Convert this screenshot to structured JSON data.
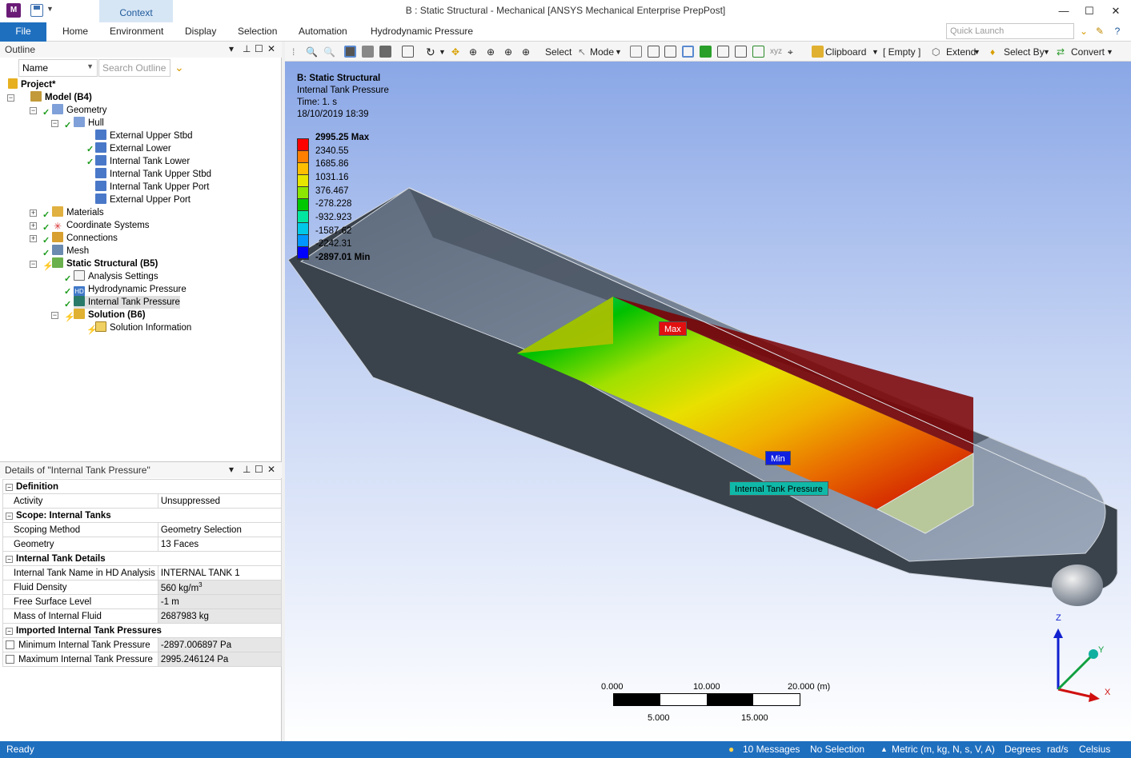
{
  "window": {
    "title": "B : Static Structural - Mechanical [ANSYS Mechanical Enterprise PrepPost]",
    "context_tab": "Context",
    "app_icon_text": "M"
  },
  "ribbon": {
    "file": "File",
    "tabs": [
      "Home",
      "Environment",
      "Display",
      "Selection",
      "Automation",
      "Hydrodynamic Pressure"
    ],
    "quick_launch_placeholder": "Quick Launch"
  },
  "outline": {
    "title": "Outline",
    "filter_value": "Name",
    "search_placeholder": "Search Outline",
    "tree": [
      {
        "label": "Project*",
        "bold": true
      },
      {
        "label": "Model (B4)",
        "bold": true
      },
      {
        "label": "Geometry",
        "bold": false
      },
      {
        "label": "Hull",
        "bold": false
      },
      {
        "label": "External Upper Stbd",
        "bold": false
      },
      {
        "label": "External Lower",
        "bold": false
      },
      {
        "label": "Internal Tank Lower",
        "bold": false
      },
      {
        "label": "Internal Tank Upper Stbd",
        "bold": false
      },
      {
        "label": "Internal Tank Upper Port",
        "bold": false
      },
      {
        "label": "External Upper Port",
        "bold": false
      },
      {
        "label": "Materials",
        "bold": false
      },
      {
        "label": "Coordinate Systems",
        "bold": false
      },
      {
        "label": "Connections",
        "bold": false
      },
      {
        "label": "Mesh",
        "bold": false
      },
      {
        "label": "Static Structural (B5)",
        "bold": true
      },
      {
        "label": "Analysis Settings",
        "bold": false
      },
      {
        "label": "Hydrodynamic Pressure",
        "bold": false
      },
      {
        "label": "Internal Tank Pressure",
        "bold": false
      },
      {
        "label": "Solution (B6)",
        "bold": true
      },
      {
        "label": "Solution Information",
        "bold": false
      }
    ]
  },
  "details": {
    "title": "Details of \"Internal Tank Pressure\"",
    "groups": {
      "definition": "Definition",
      "scope": "Scope: Internal Tanks",
      "tank": "Internal Tank Details",
      "imported": "Imported Internal Tank Pressures"
    },
    "rows": {
      "activity": [
        "Activity",
        "Unsuppressed"
      ],
      "scoping": [
        "Scoping Method",
        "Geometry Selection"
      ],
      "geometry": [
        "Geometry",
        "13 Faces"
      ],
      "tank_name": [
        "Internal Tank Name in HD Analysis",
        "INTERNAL TANK 1"
      ],
      "fluid_density": [
        "Fluid Density",
        "560 kg/m"
      ],
      "fluid_density_exp": "3",
      "free_surface": [
        "Free Surface Level",
        "-1 m"
      ],
      "mass": [
        "Mass of Internal Fluid",
        "2687983 kg"
      ],
      "min_pressure": [
        "Minimum Internal Tank Pressure",
        "-2897.006897 Pa"
      ],
      "max_pressure": [
        "Maximum Internal Tank Pressure",
        "2995.246124 Pa"
      ]
    }
  },
  "graphics_toolbar": {
    "select": "Select",
    "mode": "Mode",
    "clipboard": "Clipboard",
    "empty": "[ Empty ]",
    "extend": "Extend",
    "select_by": "Select By",
    "convert": "Convert"
  },
  "viewport": {
    "analysis": "B: Static Structural",
    "result": "Internal Tank Pressure",
    "time": "Time: 1. s",
    "date": "18/10/2019 18:39",
    "legend": [
      "2995.25 Max",
      "2340.55",
      "1685.86",
      "1031.16",
      "376.467",
      "-278.228",
      "-932.923",
      "-1587.62",
      "-2242.31",
      "-2897.01 Min"
    ],
    "legend_colors": [
      "#ff0000",
      "#ff7f00",
      "#ffbf00",
      "#e6e600",
      "#8ce600",
      "#00c800",
      "#00e6a0",
      "#00c8e6",
      "#0096ff",
      "#0000ff"
    ],
    "max_tag": "Max",
    "min_tag": "Min",
    "probe_tag": "Internal Tank Pressure",
    "scale_top": [
      "0.000",
      "10.000",
      "20.000 (m)"
    ],
    "scale_bottom": [
      "5.000",
      "15.000"
    ],
    "axes": {
      "z": "Z",
      "y": "Y",
      "x": "X"
    }
  },
  "status": {
    "ready": "Ready",
    "messages": "10 Messages",
    "selection": "No Selection",
    "units": "Metric (m, kg, N, s, V, A)",
    "angle": "Degrees",
    "rot": "rad/s",
    "temp": "Celsius"
  }
}
